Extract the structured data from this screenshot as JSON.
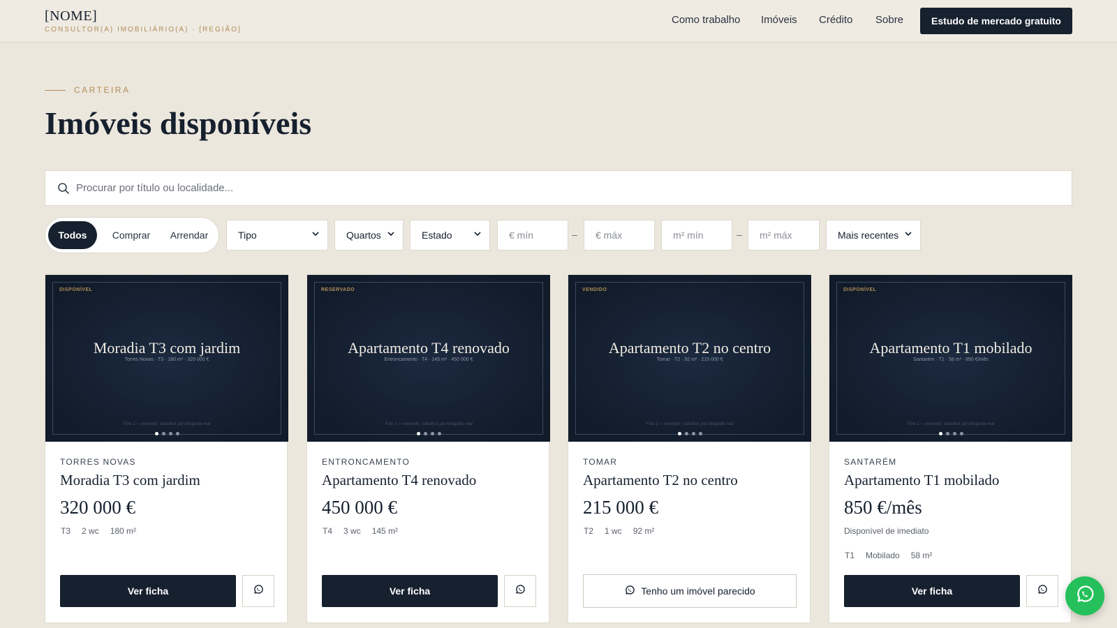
{
  "header": {
    "brand_name": "[NOME]",
    "brand_sub": "CONSULTOR(A) IMOBILIÁRIO(A) · [REGIÃO]",
    "nav": [
      "Como trabalho",
      "Imóveis",
      "Crédito",
      "Sobre"
    ],
    "cta_label": "Estudo de mercado gratuito"
  },
  "hero": {
    "eyebrow": "CARTEIRA",
    "title": "Imóveis disponíveis"
  },
  "search": {
    "placeholder": "Procurar por título ou localidade...",
    "value": ""
  },
  "filters": {
    "segments": [
      "Todos",
      "Comprar",
      "Arrendar"
    ],
    "active_segment": "Todos",
    "tipo": "Tipo",
    "quartos": "Quartos",
    "estado": "Estado",
    "price_min_placeholder": "€ mín",
    "price_max_placeholder": "€ máx",
    "area_min_placeholder": "m² mín",
    "area_max_placeholder": "m² máx",
    "range_separator": "–",
    "sort": "Mais recentes"
  },
  "cards": [
    {
      "status": "DISPONÍVEL",
      "image_title": "Moradia T3 com jardim",
      "image_sub": "Torres Novas · T3 · 180 m² · 320 000 €",
      "image_caption": "Foto 1 — exemplo, substituir por fotografia real",
      "location": "TORRES NOVAS",
      "title": "Moradia T3 com jardim",
      "price": "320 000 €",
      "specs": [
        "T3",
        "2 wc",
        "180 m²"
      ],
      "button": "Ver ficha"
    },
    {
      "status": "RESERVADO",
      "image_title": "Apartamento T4 renovado",
      "image_sub": "Entroncamento · T4 · 145 m² · 450 000 €",
      "image_caption": "Foto 1 — exemplo, substituir por fotografia real",
      "location": "ENTRONCAMENTO",
      "title": "Apartamento T4 renovado",
      "price": "450 000 €",
      "specs": [
        "T4",
        "3 wc",
        "145 m²"
      ],
      "button": "Ver ficha"
    },
    {
      "status": "VENDIDO",
      "image_title": "Apartamento T2 no centro",
      "image_sub": "Tomar · T2 · 92 m² · 215 000 €",
      "image_caption": "Foto 1 — exemplo, substituir por fotografia real",
      "location": "TOMAR",
      "title": "Apartamento T2 no centro",
      "price": "215 000 €",
      "specs": [
        "T2",
        "1 wc",
        "92 m²"
      ],
      "button": "Tenho um imóvel parecido"
    },
    {
      "status": "DISPONÍVEL",
      "image_title": "Apartamento T1 mobilado",
      "image_sub": "Santarém · T1 · 58 m² · 850 €/mês",
      "image_caption": "Foto 1 — exemplo, substituir por fotografia real",
      "location": "SANTARÉM",
      "title": "Apartamento T1 mobilado",
      "price": "850 €/mês",
      "note": "Disponível de imediato",
      "specs": [
        "T1",
        "Mobilado",
        "58 m²"
      ],
      "button": "Ver ficha"
    }
  ],
  "colors": {
    "background": "#ece7dd",
    "navy": "#16202e",
    "gold": "#b08d57",
    "whatsapp": "#25c05b"
  },
  "icons": {
    "search": "search-icon",
    "whatsapp": "whatsapp-icon",
    "chevron": "chevron-down-icon"
  }
}
